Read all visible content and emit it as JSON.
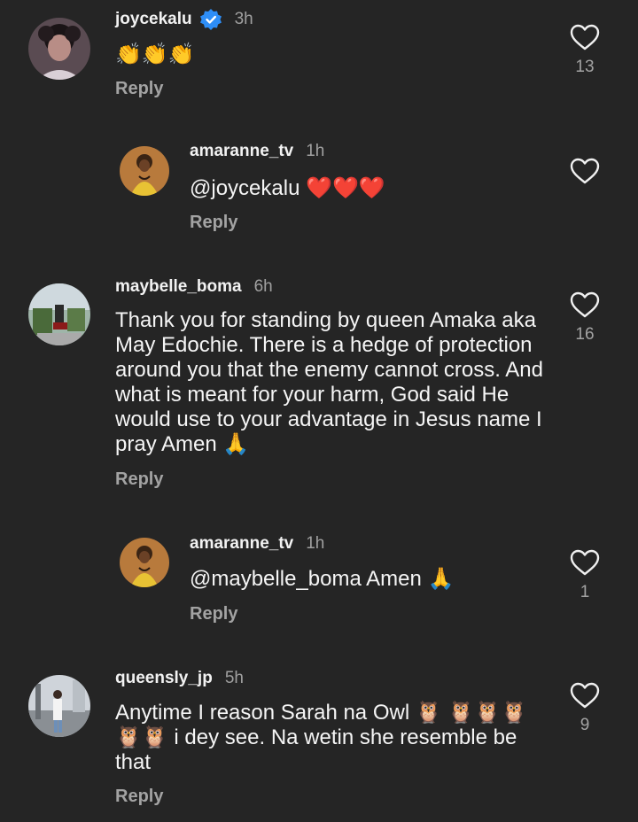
{
  "comments": [
    {
      "username": "joycekalu",
      "verified": true,
      "time": "3h",
      "text": "👏👏👏",
      "reply_label": "Reply",
      "likes": "13"
    },
    {
      "username": "amaranne_tv",
      "time": "1h",
      "text": "@joycekalu ❤️❤️❤️",
      "reply_label": "Reply",
      "likes": ""
    },
    {
      "username": "maybelle_boma",
      "time": "6h",
      "text_lines": [
        "Thank you for standing by queen Amaka aka",
        "May Edochie. There is a hedge of protection",
        "around you that the enemy cannot cross. And",
        "what is meant for your harm, God said He",
        "would use to your advantage in Jesus name I",
        "pray Amen 🙏"
      ],
      "reply_label": "Reply",
      "likes": "16"
    },
    {
      "username": "amaranne_tv",
      "time": "1h",
      "text": "@maybelle_boma Amen 🙏",
      "reply_label": "Reply",
      "likes": "1"
    },
    {
      "username": "queensly_jp",
      "time": "5h",
      "text_lines": [
        "Anytime I reason Sarah na Owl 🦉 🦉🦉🦉",
        "🦉🦉 i dey see. Na wetin she resemble be",
        "that"
      ],
      "reply_label": "Reply",
      "likes": "9"
    }
  ],
  "icons": {
    "like": "heart-outline-icon",
    "verified": "verified-badge-icon"
  },
  "colors": {
    "background": "#252525",
    "verified": "#2e8ef7",
    "secondary_text": "#a3a3a3"
  }
}
